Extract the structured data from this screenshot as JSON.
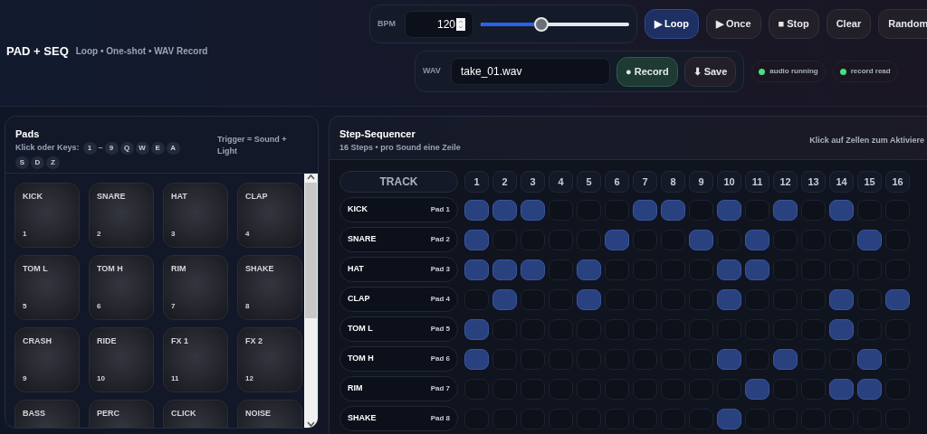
{
  "header": {
    "title": "PAD + SEQ",
    "subtitle": "Loop • One-shot • WAV Record"
  },
  "transport": {
    "bpm_label": "BPM",
    "bpm_value": "120",
    "tempo": {
      "level": 0.41
    },
    "buttons": [
      {
        "label": "▶ Loop",
        "kind": "mode",
        "selected": true
      },
      {
        "label": "▶ Once",
        "kind": "mode",
        "selected": false
      },
      {
        "label": "■ Stop",
        "kind": "action"
      },
      {
        "label": "Clear",
        "kind": "action"
      },
      {
        "label": "Random",
        "kind": "action"
      }
    ]
  },
  "recorder": {
    "label": "WAV",
    "filename": "take_01.wav",
    "buttons": [
      {
        "label": "● Record",
        "kind": "record"
      },
      {
        "label": "⬇ Save",
        "kind": "action"
      }
    ],
    "status": [
      {
        "label": "audio running",
        "color": "#4ade80"
      },
      {
        "label": "record read",
        "color": "#4ade80"
      }
    ]
  },
  "pads_panel": {
    "title": "Pads",
    "keys_label": "Klick oder Keys:",
    "keys": [
      {
        "label": "1",
        "kind": "key"
      },
      {
        "label": "–",
        "kind": "sep"
      },
      {
        "label": "9",
        "kind": "key"
      },
      {
        "label": "Q",
        "kind": "key"
      },
      {
        "label": "W",
        "kind": "key"
      },
      {
        "label": "E",
        "kind": "key"
      },
      {
        "label": "A",
        "kind": "key"
      },
      {
        "label": "S",
        "kind": "key"
      },
      {
        "label": "D",
        "kind": "key"
      },
      {
        "label": "Z",
        "kind": "key"
      }
    ],
    "hint": "Trigger = Sound + Light",
    "pads": [
      {
        "name": "KICK",
        "number": "1"
      },
      {
        "name": "SNARE",
        "number": "2"
      },
      {
        "name": "HAT",
        "number": "3"
      },
      {
        "name": "CLAP",
        "number": "4"
      },
      {
        "name": "TOM L",
        "number": "5"
      },
      {
        "name": "TOM H",
        "number": "6"
      },
      {
        "name": "RIM",
        "number": "7"
      },
      {
        "name": "SHAKE",
        "number": "8"
      },
      {
        "name": "CRASH",
        "number": "9"
      },
      {
        "name": "RIDE",
        "number": "10"
      },
      {
        "name": "FX 1",
        "number": "11"
      },
      {
        "name": "FX 2",
        "number": "12"
      },
      {
        "name": "BASS"
      },
      {
        "name": "PERC"
      },
      {
        "name": "CLICK"
      },
      {
        "name": "NOISE"
      }
    ]
  },
  "sequencer": {
    "title": "Step-Sequencer",
    "subtitle": "16 Steps • pro Sound eine Zeile",
    "hint": "Klick auf Zellen zum Aktiviere",
    "track_header": "TRACK",
    "steps": [
      "1",
      "2",
      "3",
      "4",
      "5",
      "6",
      "7",
      "8",
      "9",
      "10",
      "11",
      "12",
      "13",
      "14",
      "15",
      "16"
    ],
    "tracks": [
      {
        "name": "KICK",
        "pad": "Pad 1",
        "cells": [
          true,
          true,
          true,
          false,
          false,
          false,
          true,
          true,
          false,
          true,
          false,
          true,
          false,
          true,
          false,
          false
        ]
      },
      {
        "name": "SNARE",
        "pad": "Pad 2",
        "cells": [
          true,
          false,
          false,
          false,
          false,
          true,
          false,
          false,
          true,
          false,
          true,
          false,
          false,
          false,
          true,
          false
        ]
      },
      {
        "name": "HAT",
        "pad": "Pad 3",
        "cells": [
          true,
          true,
          true,
          false,
          true,
          false,
          false,
          false,
          false,
          true,
          true,
          false,
          false,
          false,
          false,
          false
        ]
      },
      {
        "name": "CLAP",
        "pad": "Pad 4",
        "cells": [
          false,
          true,
          false,
          false,
          true,
          false,
          false,
          false,
          false,
          true,
          false,
          false,
          false,
          true,
          false,
          true
        ]
      },
      {
        "name": "TOM L",
        "pad": "Pad 5",
        "cells": [
          true,
          false,
          false,
          false,
          false,
          false,
          false,
          false,
          false,
          false,
          false,
          false,
          false,
          true,
          false,
          false
        ]
      },
      {
        "name": "TOM H",
        "pad": "Pad 6",
        "cells": [
          true,
          false,
          false,
          false,
          false,
          false,
          false,
          false,
          false,
          true,
          false,
          true,
          false,
          false,
          true,
          false
        ]
      },
      {
        "name": "RIM",
        "pad": "Pad 7",
        "cells": [
          false,
          false,
          false,
          false,
          false,
          false,
          false,
          false,
          false,
          false,
          true,
          false,
          false,
          true,
          true,
          false
        ]
      },
      {
        "name": "SHAKE",
        "pad": "Pad 8",
        "cells": [
          false,
          false,
          false,
          false,
          false,
          false,
          false,
          false,
          false,
          true,
          false,
          false,
          false,
          false,
          false,
          false
        ]
      }
    ]
  }
}
